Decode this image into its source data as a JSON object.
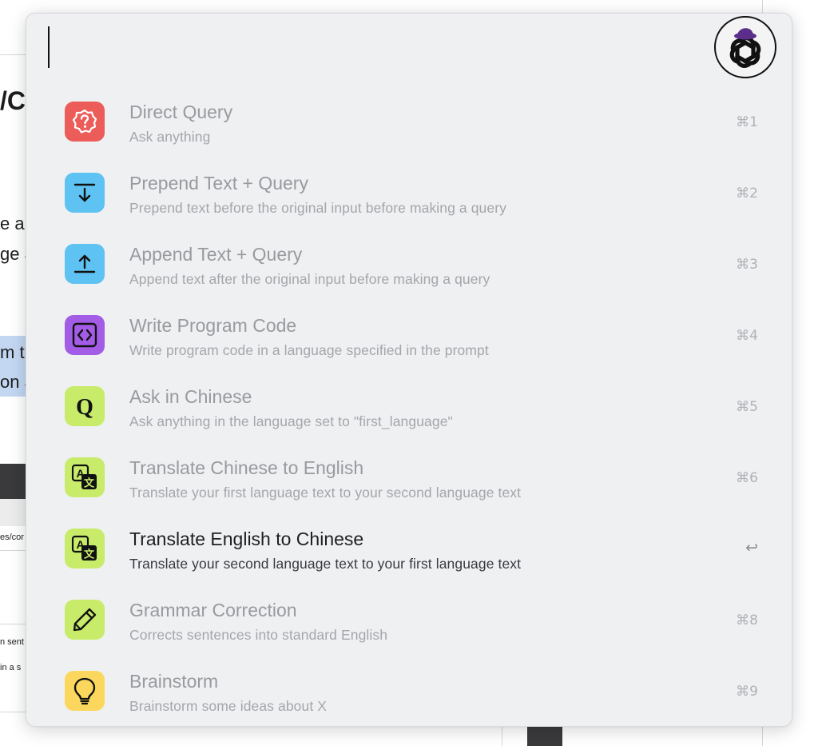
{
  "background": {
    "heading_fragment": "/Co",
    "line1_fragment": "e a",
    "line2_fragment": "ge a",
    "hl1_fragment": "m t",
    "hl2_fragment": "on a",
    "path_fragment": "es/cor",
    "small1_fragment": "n sent",
    "small2_fragment": "in a s"
  },
  "launcher": {
    "search": {
      "value": "",
      "placeholder": ""
    },
    "logo_icon": "openai-logo-with-hat-icon",
    "items": [
      {
        "title": "Direct Query",
        "subtitle": "Ask anything",
        "shortcut": "⌘1",
        "icon": "question-badge-icon",
        "icon_bg": "#ec5c59"
      },
      {
        "title": "Prepend Text + Query",
        "subtitle": "Prepend text before the original input before making a query",
        "shortcut": "⌘2",
        "icon": "arrow-down-to-line-icon",
        "icon_bg": "#5ec2f2"
      },
      {
        "title": "Append Text + Query",
        "subtitle": "Append text after the original input before making a query",
        "shortcut": "⌘3",
        "icon": "arrow-up-to-line-icon",
        "icon_bg": "#5ec2f2"
      },
      {
        "title": "Write Program Code",
        "subtitle": "Write program code in a language specified in the prompt",
        "shortcut": "⌘4",
        "icon": "code-brackets-icon",
        "icon_bg": "#a35ce6"
      },
      {
        "title": "Ask in Chinese",
        "subtitle": "Ask anything in the language set to \"first_language\"",
        "shortcut": "⌘5",
        "icon": "letter-q-icon",
        "icon_bg": "#c8ec6a"
      },
      {
        "title": "Translate Chinese to English",
        "subtitle": "Translate your first language text to your second language text",
        "shortcut": "⌘6",
        "icon": "translate-icon",
        "icon_bg": "#c8ec6a"
      },
      {
        "title": "Translate English to Chinese",
        "subtitle": "Translate your second language text to your first language text",
        "shortcut": "↩",
        "icon": "translate-icon",
        "icon_bg": "#c8ec6a",
        "selected": true
      },
      {
        "title": "Grammar Correction",
        "subtitle": "Corrects sentences into standard English",
        "shortcut": "⌘8",
        "icon": "pencil-icon",
        "icon_bg": "#c8ec6a"
      },
      {
        "title": "Brainstorm",
        "subtitle": "Brainstorm some ideas about X",
        "shortcut": "⌘9",
        "icon": "lightbulb-icon",
        "icon_bg": "#fbd85d"
      }
    ]
  }
}
